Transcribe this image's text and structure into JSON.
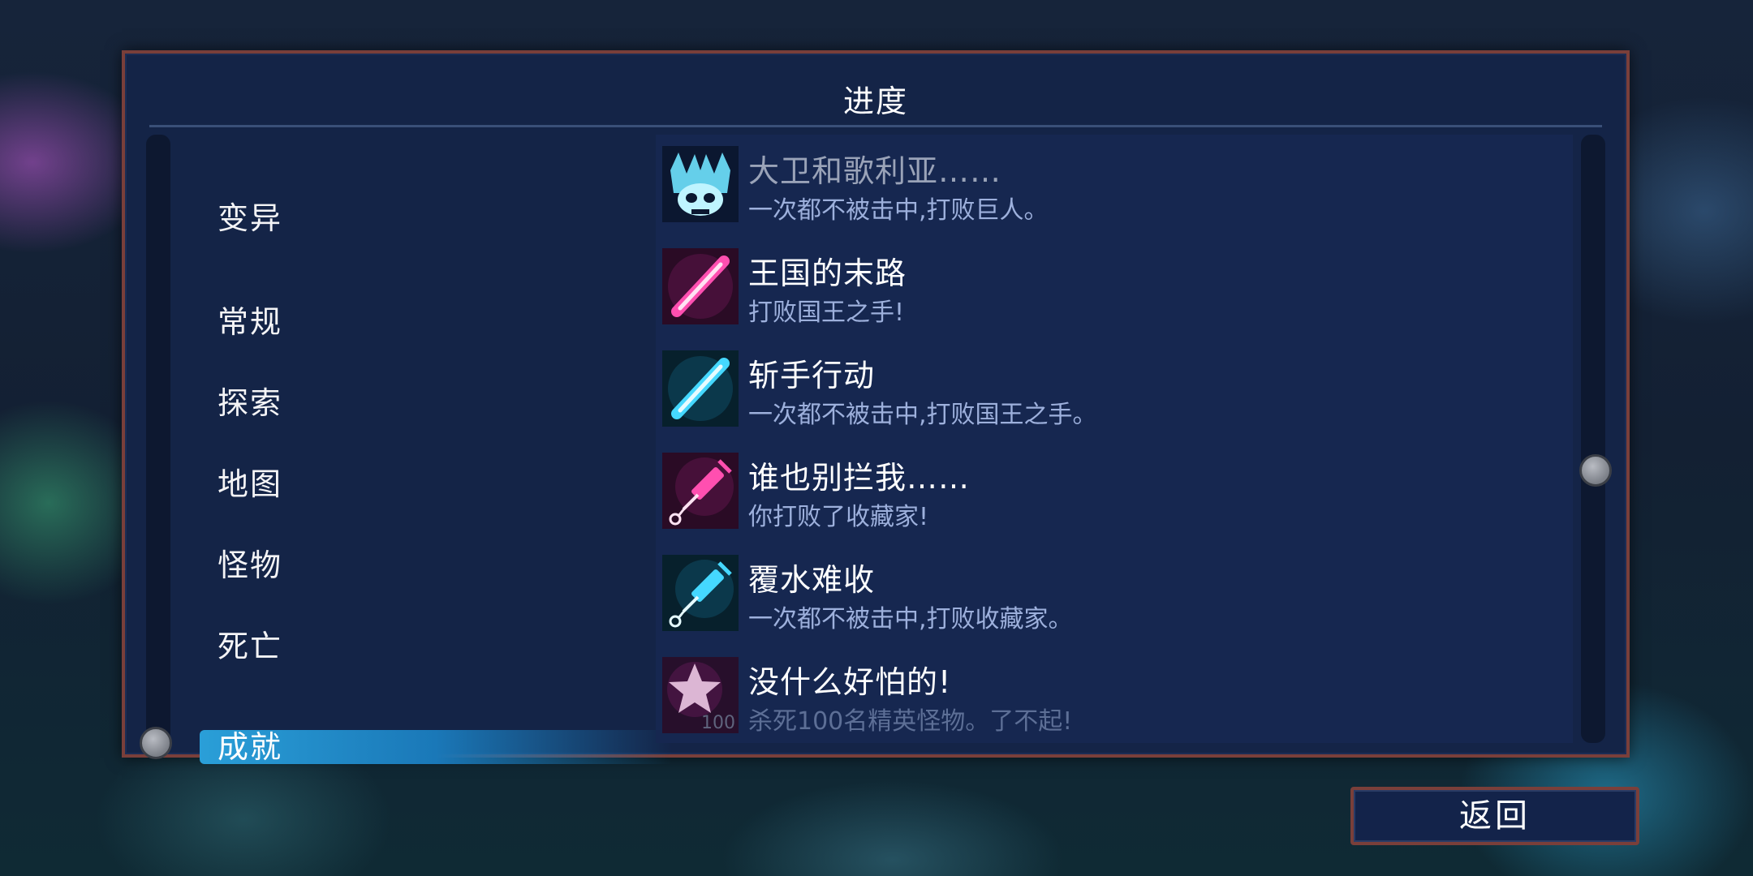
{
  "panel": {
    "title": "进度"
  },
  "sidebar": {
    "items": [
      {
        "label": "变异"
      },
      {
        "label": "常规"
      },
      {
        "label": "探索"
      },
      {
        "label": "地图"
      },
      {
        "label": "怪物"
      },
      {
        "label": "死亡"
      },
      {
        "label": "成就",
        "active": true
      }
    ]
  },
  "achievements": [
    {
      "title": "大卫和歌利亚……",
      "description": "一次都不被击中,打败巨人。",
      "icon": "giant-skull-icon",
      "color": "#6fe3ff",
      "locked": true
    },
    {
      "title": "王国的末路",
      "description": "打败国王之手!",
      "icon": "sword-icon",
      "color": "#ff4fb0"
    },
    {
      "title": "斩手行动",
      "description": "一次都不被击中,打败国王之手。",
      "icon": "sword-icon",
      "color": "#45d8ff"
    },
    {
      "title": "谁也别拦我……",
      "description": "你打败了收藏家!",
      "icon": "syringe-icon",
      "color": "#ff4fb0"
    },
    {
      "title": "覆水难收",
      "description": "一次都不被击中,打败收藏家。",
      "icon": "syringe-icon",
      "color": "#45d8ff"
    },
    {
      "title": "没什么好怕的!",
      "description": "杀死100名精英怪物。了不起!",
      "icon": "star-icon",
      "color": "#ff4fb0",
      "badge": "100"
    }
  ],
  "footer": {
    "back_label": "返回"
  }
}
